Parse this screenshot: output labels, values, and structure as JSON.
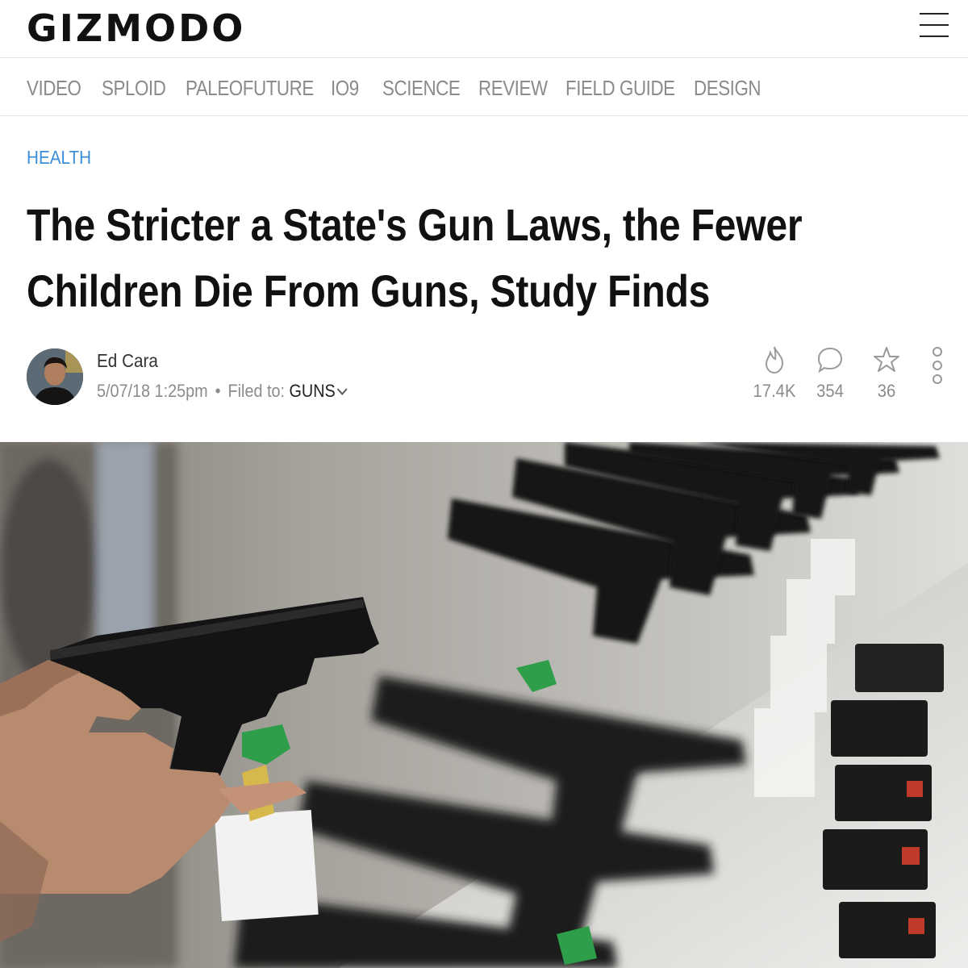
{
  "header": {
    "logo": "GIZMODO",
    "menu_icon": "hamburger-menu-icon"
  },
  "nav": {
    "items": [
      "VIDEO",
      "SPLOID",
      "PALEOFUTURE",
      "IO9",
      "SCIENCE",
      "REVIEW",
      "FIELD GUIDE",
      "DESIGN"
    ]
  },
  "article": {
    "category": "HEALTH",
    "headline_line1": "The Stricter a State's Gun Laws, the Fewer",
    "headline_line2": "Children Die From Guns, Study Finds",
    "author": "Ed Cara",
    "date": "5/07/18 1:25pm",
    "separator": "•",
    "filed_label": "Filed to:",
    "filed_tag": "GUNS"
  },
  "stats": {
    "views": "17.4K",
    "views_icon": "flame-icon",
    "comments": "354",
    "comments_icon": "comment-bubble-icon",
    "stars": "36",
    "stars_icon": "star-icon",
    "more_icon": "more-options-icon"
  },
  "colors": {
    "category": "#3b8dd8",
    "nav_text": "#8b8b8b",
    "headline": "#111111"
  }
}
